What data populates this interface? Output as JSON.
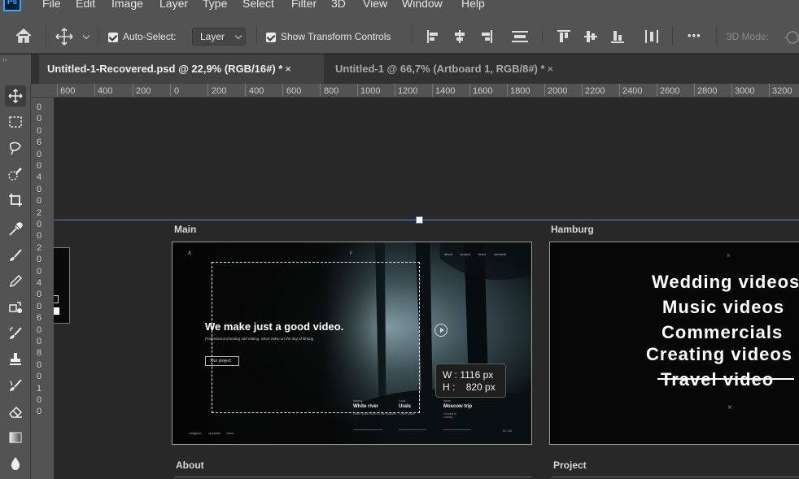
{
  "app": {
    "logo": "Ps",
    "menu": [
      "File",
      "Edit",
      "Image",
      "Layer",
      "Type",
      "Select",
      "Filter",
      "3D",
      "View",
      "Window",
      "Help"
    ]
  },
  "options": {
    "home_icon": "home-icon",
    "move_icon": "move-icon",
    "auto_select_label": "Auto-Select:",
    "auto_select_checked": true,
    "auto_select_target": "Layer",
    "show_transform_label": "Show Transform Controls",
    "show_transform_checked": true,
    "more_label": "•••",
    "mode_3d_label": "3D Mode:"
  },
  "tabs": [
    {
      "label": "Untitled-1-Recovered.psd @ 22,9% (RGB/16#) *",
      "close": "×",
      "active": true
    },
    {
      "label": "Untitled-1 @ 66,7% (Artboard 1, RGB/8#) *",
      "close": "×",
      "active": false
    }
  ],
  "ruler": {
    "h_labels": [
      "600",
      "400",
      "200",
      "0",
      "200",
      "400",
      "600",
      "800",
      "1000",
      "1200",
      "1400",
      "1600",
      "1800",
      "2000",
      "2200",
      "2400",
      "2600",
      "2800",
      "3000",
      "3200"
    ],
    "v_labels": [
      "0",
      "0",
      "0",
      "6",
      "0",
      "0",
      "4",
      "0",
      "0",
      "2",
      "0",
      "0",
      "2",
      "0",
      "0",
      "4",
      "0",
      "0",
      "6",
      "0",
      "0",
      "8",
      "0",
      "0",
      "1",
      "0",
      "0"
    ]
  },
  "tools": [
    "move-tool-icon",
    "marquee-tool-icon",
    "lasso-tool-icon",
    "quick-select-tool-icon",
    "crop-tool-icon",
    "eyedropper-tool-icon",
    "healing-brush-tool-icon",
    "brush-tool-icon",
    "clone-stamp-tool-icon",
    "history-brush-tool-icon",
    "eraser-tool-icon",
    "gradient-tool-icon",
    "blur-tool-icon"
  ],
  "artboards": {
    "main": {
      "label": "Main",
      "nav": [
        "about",
        "project",
        "team",
        "contacts"
      ],
      "logo_mark": "⋏",
      "center_mark": "II",
      "hero_title": "We make just a good video.",
      "hero_subtitle": "Professional shooting and editing. Short video on the day of filming",
      "hero_button": "Our project",
      "projects": [
        {
          "tag": "Nearby",
          "title": "White river",
          "desc": "Lorem ipsum dolor of the Rockline"
        },
        {
          "tag": "Local",
          "title": "Urals",
          "desc": "Lorem ipsum"
        },
        {
          "tag": "Spark",
          "title": "Moscow trip",
          "desc": "Country to country"
        }
      ],
      "footer_links": [
        "instagram",
        "vkontakte",
        "vimeo"
      ],
      "page_counter": "01 / 04"
    },
    "hamburg": {
      "label": "Hamburg",
      "center_mark": "II",
      "items": [
        "Wedding videos",
        "Music videos",
        "Commercials",
        "Creating videos",
        "Travel video"
      ],
      "close_mark": "×"
    },
    "about": {
      "label": "About"
    },
    "project": {
      "label": "Project"
    }
  },
  "transform": {
    "w_label": "W :",
    "w_value": "1116 px",
    "h_label": "H :",
    "h_value": "820 px"
  },
  "colors": {
    "accent": "#31a8ff",
    "annotation_red": "#d21f1f",
    "guide": "#5b88c7"
  }
}
